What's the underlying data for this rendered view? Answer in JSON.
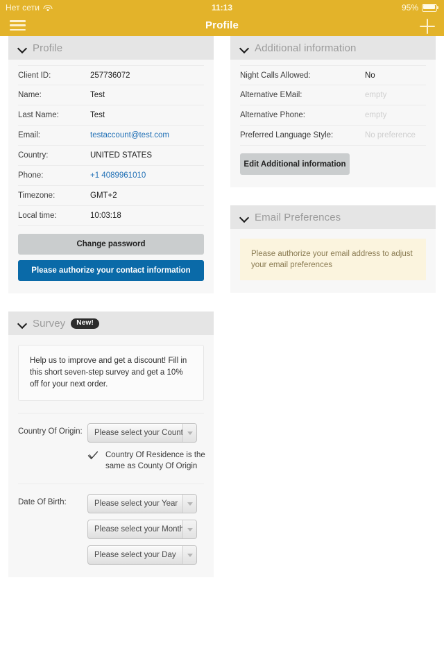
{
  "status_bar": {
    "network_text": "Нет сети",
    "wifi_icon": "wifi-icon",
    "time": "11:13",
    "battery_percent": "95%",
    "battery_icon": "battery-icon"
  },
  "nav": {
    "title": "Profile",
    "menu_icon": "hamburger-menu-icon",
    "add_icon": "plus-icon"
  },
  "theme": {
    "accent": "#e3b32a",
    "link": "#1f6fb5",
    "primary_button": "#0a6aa8",
    "secondary_button": "#cacdce",
    "notice_bg": "#fbf4de",
    "card_bg": "#f7f7f7",
    "card_header_bg": "#e5e5e5"
  },
  "profile_card": {
    "title": "Profile",
    "collapse_icon": "chevron-down-icon",
    "rows": [
      {
        "label": "Client ID:",
        "value": "257736072",
        "style": "plain"
      },
      {
        "label": "Name:",
        "value": "Test",
        "style": "plain"
      },
      {
        "label": "Last Name:",
        "value": "Test",
        "style": "plain"
      },
      {
        "label": "Email:",
        "value": "testaccount@test.com",
        "style": "link"
      },
      {
        "label": "Country:",
        "value": "UNITED STATES",
        "style": "plain"
      },
      {
        "label": "Phone:",
        "value": "+1 4089961010",
        "style": "link"
      },
      {
        "label": "Timezone:",
        "value": "GMT+2",
        "style": "plain"
      },
      {
        "label": "Local time:",
        "value": "10:03:18",
        "style": "plain"
      }
    ],
    "change_password_label": "Change password",
    "authorize_label": "Please authorize your contact information"
  },
  "additional_info_card": {
    "title": "Additional information",
    "collapse_icon": "chevron-down-icon",
    "rows": [
      {
        "label": "Night Calls Allowed:",
        "value": "No",
        "style": "plain"
      },
      {
        "label": "Alternative EMail:",
        "value": "empty",
        "style": "muted"
      },
      {
        "label": "Alternative Phone:",
        "value": "empty",
        "style": "muted"
      },
      {
        "label": "Preferred Language Style:",
        "value": "No preference",
        "style": "muted"
      }
    ],
    "edit_label": "Edit Additional information"
  },
  "email_preferences_card": {
    "title": "Email Preferences",
    "collapse_icon": "chevron-down-icon",
    "notice": "Please authorize your email address to adjust your email preferences"
  },
  "survey_card": {
    "title": "Survey",
    "badge": "New!",
    "collapse_icon": "chevron-down-icon",
    "intro": "Help us to improve and get a discount! Fill in this short seven-step survey and get a 10% off for your next order.",
    "country_label": "Country Of Origin:",
    "country_select_value": "Please select your Country",
    "checkbox_icon": "check-mark-icon",
    "checkbox_label": "Country Of Residence is the same as County Of Origin",
    "dob_label": "Date Of Birth:",
    "dob_year_value": "Please select your Year",
    "dob_month_value": "Please select your Month",
    "dob_day_value": "Please select your Day",
    "dropdown_arrow_icon": "chevron-down-icon"
  }
}
